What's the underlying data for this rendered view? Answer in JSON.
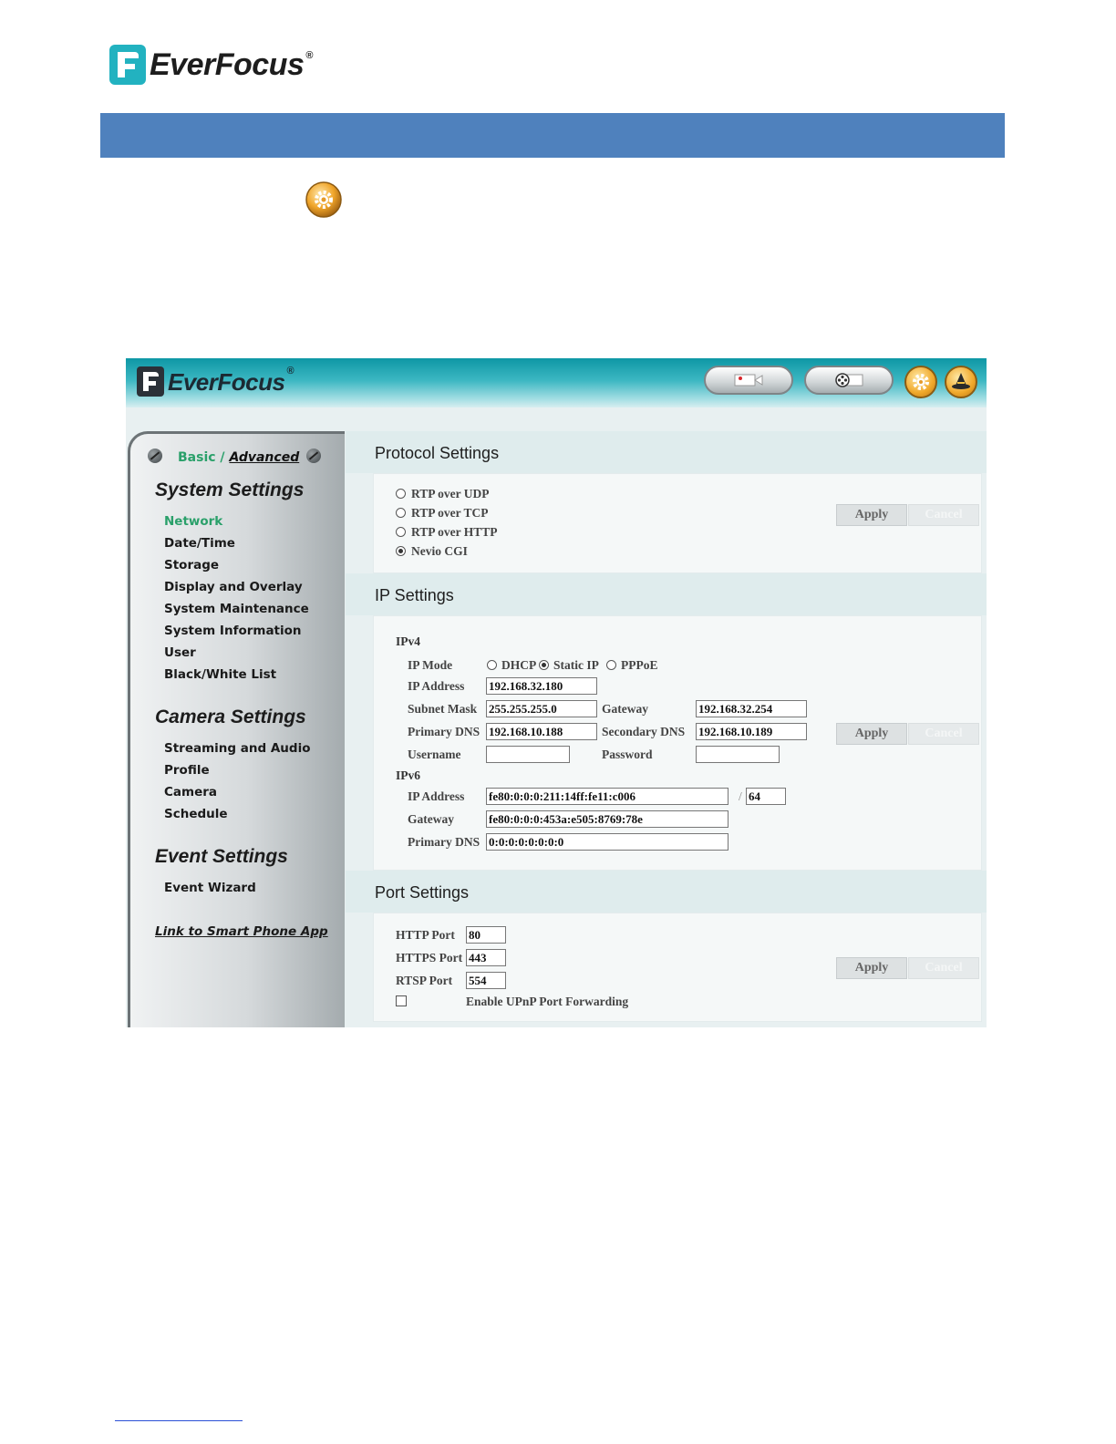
{
  "document": {
    "logo_text": "EverFocus",
    "logo_mark": "®"
  },
  "app": {
    "logo_text": "EverFocus",
    "logo_mark": "®",
    "toolbar_icons": [
      "camera-live-icon",
      "playback-reel-icon",
      "settings-gear-icon",
      "wizard-hat-icon"
    ]
  },
  "sidebar": {
    "mode_basic": "Basic",
    "mode_sep": " / ",
    "mode_advanced": "Advanced",
    "system_heading": "System Settings",
    "system_items": [
      "Network",
      "Date/Time",
      "Storage",
      "Display and Overlay",
      "System Maintenance",
      "System Information",
      "User",
      "Black/White List"
    ],
    "camera_heading": "Camera Settings",
    "camera_items": [
      "Streaming and Audio",
      "Profile",
      "Camera",
      "Schedule"
    ],
    "event_heading": "Event Settings",
    "event_items": [
      "Event Wizard"
    ],
    "smart_link": "Link to Smart Phone App"
  },
  "protocol": {
    "title": "Protocol Settings",
    "options": [
      "RTP over UDP",
      "RTP over TCP",
      "RTP over HTTP",
      "Nevio CGI"
    ],
    "selected": "Nevio CGI",
    "apply": "Apply",
    "cancel": "Cancel"
  },
  "ip": {
    "title": "IP Settings",
    "ipv4_label": "IPv4",
    "ip_mode_label": "IP Mode",
    "modes": [
      "DHCP",
      "Static IP",
      "PPPoE"
    ],
    "selected_mode": "Static IP",
    "ip_address_label": "IP Address",
    "ip_address": "192.168.32.180",
    "subnet_label": "Subnet Mask",
    "subnet": "255.255.255.0",
    "gateway_label": "Gateway",
    "gateway": "192.168.32.254",
    "primary_dns_label": "Primary DNS",
    "primary_dns": "192.168.10.188",
    "secondary_dns_label": "Secondary DNS",
    "secondary_dns": "192.168.10.189",
    "username_label": "Username",
    "username": "",
    "password_label": "Password",
    "password": "",
    "ipv6_label": "IPv6",
    "v6_ip_address_label": "IP Address",
    "v6_ip_address": "fe80:0:0:0:211:14ff:fe11:c006",
    "v6_prefix_sep": "/",
    "v6_prefix": "64",
    "v6_gateway_label": "Gateway",
    "v6_gateway": "fe80:0:0:0:453a:e505:8769:78e",
    "v6_primary_dns_label": "Primary DNS",
    "v6_primary_dns": "0:0:0:0:0:0:0:0",
    "apply": "Apply",
    "cancel": "Cancel"
  },
  "port": {
    "title": "Port Settings",
    "http_label": "HTTP Port",
    "http": "80",
    "https_label": "HTTPS Port",
    "https": "443",
    "rtsp_label": "RTSP Port",
    "rtsp": "554",
    "upnp_label": "Enable UPnP Port Forwarding",
    "upnp_checked": false,
    "apply": "Apply",
    "cancel": "Cancel"
  }
}
